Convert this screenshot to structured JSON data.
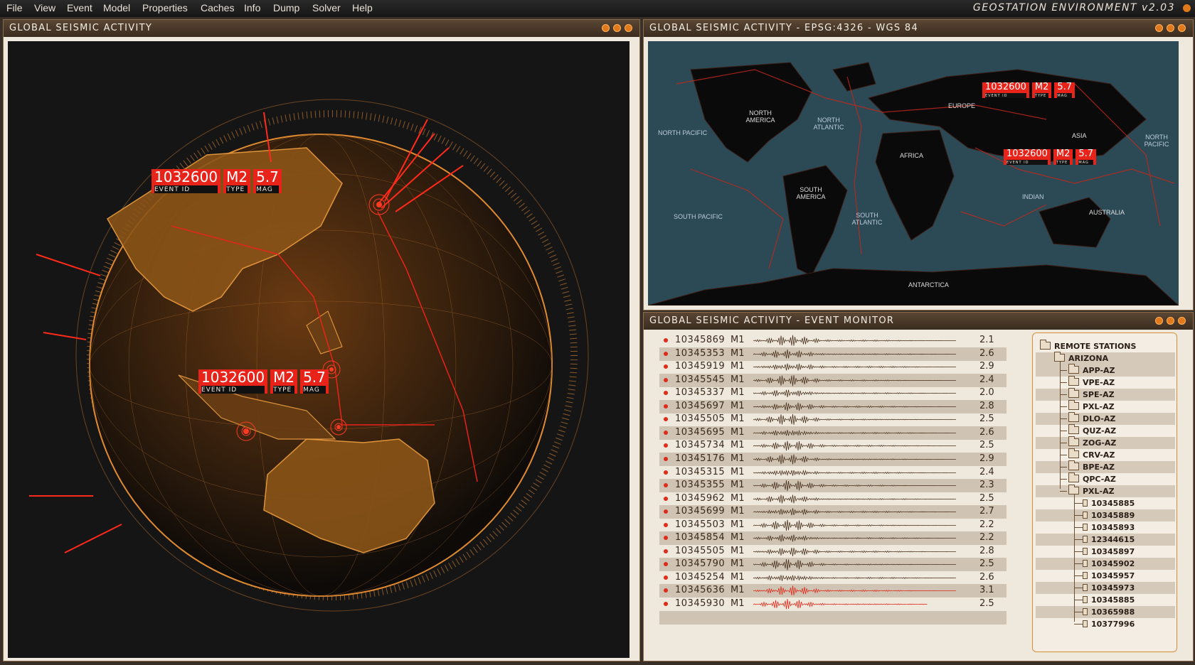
{
  "menubar": {
    "items": [
      "File",
      "View",
      "Event",
      "Model",
      "Properties",
      "Caches",
      "Info",
      "Dump",
      "Solver",
      "Help"
    ],
    "app_title": "GEOSTATION ENVIRONMENT v2.03"
  },
  "globe_panel": {
    "title": "GLOBAL SEISMIC ACTIVITY",
    "labels": [
      {
        "event_id": "1032600",
        "type": "M2",
        "mag": "5.7",
        "cap_id": "EVENT ID",
        "cap_type": "TYPE",
        "cap_mag": "MAG"
      },
      {
        "event_id": "1032600",
        "type": "M2",
        "mag": "5.7",
        "cap_id": "EVENT ID",
        "cap_type": "TYPE",
        "cap_mag": "MAG"
      }
    ]
  },
  "map_panel": {
    "title": "GLOBAL SEISMIC ACTIVITY - EPSG:4326 - WGS 84",
    "regions": [
      "NORTH AMERICA",
      "NORTH PACIFIC",
      "NORTH ATLANTIC",
      "EUROPE",
      "ASIA",
      "NORTH PACIFIC",
      "AFRICA",
      "SOUTH AMERICA",
      "SOUTH PACIFIC",
      "SOUTH ATLANTIC",
      "INDIAN",
      "AUSTRALIA",
      "ANTARCTICA"
    ],
    "labels": [
      {
        "event_id": "1032600",
        "type": "M2",
        "mag": "5.7",
        "cap_id": "EVENT ID",
        "cap_type": "TYPE",
        "cap_mag": "MAG"
      },
      {
        "event_id": "1032600",
        "type": "M2",
        "mag": "5.7",
        "cap_id": "EVENT ID",
        "cap_type": "TYPE",
        "cap_mag": "MAG"
      }
    ]
  },
  "monitor_panel": {
    "title": "GLOBAL SEISMIC ACTIVITY - EVENT MONITOR",
    "events": [
      {
        "id": "10345869",
        "type": "M1",
        "mag": "2.1"
      },
      {
        "id": "10345353",
        "type": "M1",
        "mag": "2.6"
      },
      {
        "id": "10345919",
        "type": "M1",
        "mag": "2.9"
      },
      {
        "id": "10345545",
        "type": "M1",
        "mag": "2.4"
      },
      {
        "id": "10345337",
        "type": "M1",
        "mag": "2.0"
      },
      {
        "id": "10345697",
        "type": "M1",
        "mag": "2.8"
      },
      {
        "id": "10345505",
        "type": "M1",
        "mag": "2.5"
      },
      {
        "id": "10345695",
        "type": "M1",
        "mag": "2.6"
      },
      {
        "id": "10345734",
        "type": "M1",
        "mag": "2.5"
      },
      {
        "id": "10345176",
        "type": "M1",
        "mag": "2.9"
      },
      {
        "id": "10345315",
        "type": "M1",
        "mag": "2.4"
      },
      {
        "id": "10345355",
        "type": "M1",
        "mag": "2.3"
      },
      {
        "id": "10345962",
        "type": "M1",
        "mag": "2.5"
      },
      {
        "id": "10345699",
        "type": "M1",
        "mag": "2.7"
      },
      {
        "id": "10345503",
        "type": "M1",
        "mag": "2.2"
      },
      {
        "id": "10345854",
        "type": "M1",
        "mag": "2.2"
      },
      {
        "id": "10345505",
        "type": "M1",
        "mag": "2.8"
      },
      {
        "id": "10345790",
        "type": "M1",
        "mag": "2.5"
      },
      {
        "id": "10345254",
        "type": "M1",
        "mag": "2.6"
      },
      {
        "id": "10345636",
        "type": "M1",
        "mag": "3.1",
        "highlight": true
      },
      {
        "id": "10345930",
        "type": "M1",
        "mag": "2.5",
        "highlight": true
      }
    ],
    "tree": {
      "root": "REMOTE STATIONS",
      "region": "ARIZONA",
      "stations": [
        "APP-AZ",
        "VPE-AZ",
        "SPE-AZ",
        "PXL-AZ",
        "DLO-AZ",
        "QUZ-AZ",
        "ZOG-AZ",
        "CRV-AZ",
        "BPE-AZ",
        "QPC-AZ",
        "PXL-AZ"
      ],
      "events": [
        "10345885",
        "10345889",
        "10345893",
        "12344615",
        "10345897",
        "10345902",
        "10345957",
        "10345973",
        "10345885",
        "10365988",
        "10377996"
      ]
    }
  },
  "colors": {
    "accent": "#e0781c",
    "alert": "#e8231a",
    "panel_bg": "#efe8dd"
  }
}
